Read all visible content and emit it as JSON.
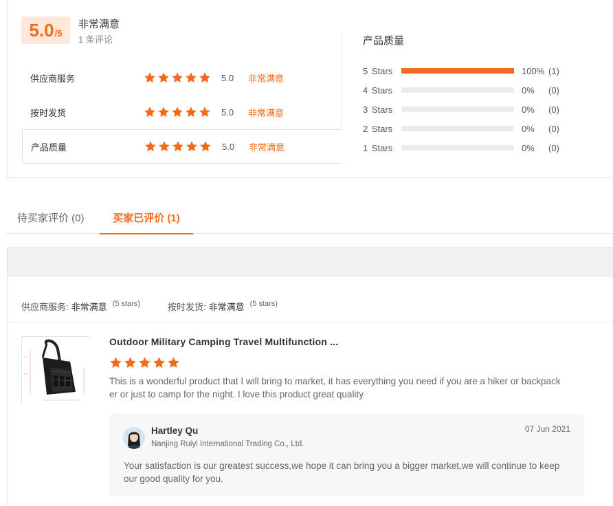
{
  "summary": {
    "score": "5.0",
    "score_max": "/5",
    "overall_label": "非常满意",
    "review_count": "1 条评论",
    "dimensions": [
      {
        "label": "供应商服务",
        "stars": 5,
        "score": "5.0",
        "text": "非常满意"
      },
      {
        "label": "按时发货",
        "stars": 5,
        "score": "5.0",
        "text": "非常满意"
      },
      {
        "label": "产品质量",
        "stars": 5,
        "score": "5.0",
        "text": "非常满意"
      }
    ],
    "quality_title": "产品质量",
    "distribution": [
      {
        "label": "5 Stars",
        "fraction": 1.0,
        "percent": "100%",
        "count": "(1)"
      },
      {
        "label": "4 Stars",
        "fraction": 0.0,
        "percent": "0%",
        "count": "(0)"
      },
      {
        "label": "3 Stars",
        "fraction": 0.0,
        "percent": "0%",
        "count": "(0)"
      },
      {
        "label": "2 Stars",
        "fraction": 0.0,
        "percent": "0%",
        "count": "(0)"
      },
      {
        "label": "1 Stars",
        "fraction": 0.0,
        "percent": "0%",
        "count": "(0)"
      }
    ]
  },
  "tabs": [
    {
      "label": "待买家评价 (0)",
      "active": false
    },
    {
      "label": "买家已评价 (1)",
      "active": true
    }
  ],
  "review_meta": {
    "supplier_key": "供应商服务:",
    "supplier_val": "非常满意",
    "supplier_stars": "(5 stars)",
    "shipping_key": "按时发货:",
    "shipping_val": "非常满意",
    "shipping_stars": "(5 stars)"
  },
  "review": {
    "product_title": "Outdoor Military Camping Travel Multifunction ...",
    "stars": 5,
    "text": "This is a wonderful product that I will bring to market, it has everything you need if you are a hiker or backpacker or just to camp for the night. I love this product great quality",
    "reply": {
      "name": "Hartley Qu",
      "company": "Nanjing Ruiyi International Trading Co., Ltd.",
      "date": "07 Jun 2021",
      "text": "Your satisfaction is our greatest success,we hope it can bring you a bigger market,we will continue to keep our good quality for you."
    }
  },
  "colors": {
    "accent": "#f46a1a",
    "score_bg": "#fde8da",
    "bar_track": "#ececec"
  },
  "icons": {
    "star": "star-icon"
  }
}
